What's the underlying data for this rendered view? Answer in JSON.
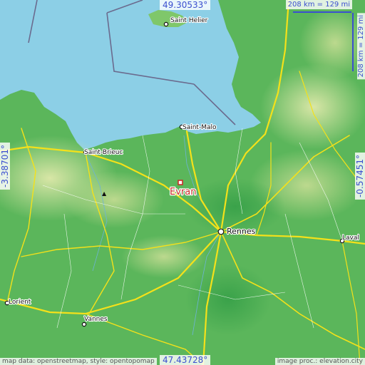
{
  "map": {
    "selected_place": "Evran",
    "places": [
      {
        "id": "saint-helier",
        "name": "Saint Helier"
      },
      {
        "id": "saint-malo",
        "name": "Saint-Malo"
      },
      {
        "id": "saint-brieuc",
        "name": "Saint-Brieuc"
      },
      {
        "id": "rennes",
        "name": "Rennes"
      },
      {
        "id": "laval",
        "name": "Laval"
      },
      {
        "id": "lorient",
        "name": "Lorient"
      },
      {
        "id": "vannes",
        "name": "Vannes"
      }
    ],
    "colors": {
      "sea": "#8ccfe6",
      "land": "#5bb65b",
      "roads": "#f4e11a",
      "selected": "#c8302a",
      "overlay_text": "#3b4fcf"
    }
  },
  "coordinates": {
    "north": "49.30533°",
    "south": "47.43728°",
    "west": "-3.38701°",
    "east": "-0.57451°"
  },
  "scale": {
    "horizontal": "208 km = 129 mi",
    "vertical": "208 km = 129 mi"
  },
  "attribution": {
    "left": "map data: openstreetmap, style: opentopomap",
    "right": "image proc.: elevation.city"
  }
}
